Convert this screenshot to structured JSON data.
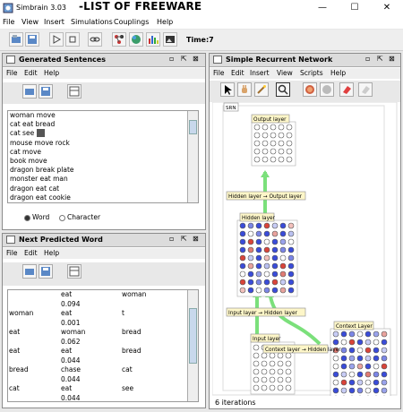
{
  "app": {
    "title": "Simbrain 3.03",
    "overlay_title": "-LIST OF FREEWARE",
    "window_controls": [
      "—",
      "☐",
      "✕"
    ]
  },
  "menubar": [
    "File",
    "View",
    "Insert",
    "Simulations",
    "Couplings",
    "Help"
  ],
  "toolbar": {
    "time_label": "Time:7"
  },
  "generated": {
    "title": "Generated Sentences",
    "menu": [
      "File",
      "Edit",
      "Help"
    ],
    "sentences": [
      "woman move",
      "cat eat bread",
      "cat see",
      "mouse move rock",
      "cat move",
      "book move",
      "dragon break plate",
      "monster eat man",
      "dragon eat cat",
      "dragon eat cookie"
    ],
    "radio_word": "Word",
    "radio_character": "Character"
  },
  "predicted": {
    "title": "Next Predicted Word",
    "menu": [
      "File",
      "Edit",
      "Help"
    ],
    "rows": [
      {
        "a": "",
        "b": "eat",
        "c": "woman"
      },
      {
        "a": "",
        "b": "0.094",
        "c": ""
      },
      {
        "a": "woman",
        "b": "eat",
        "c": "t"
      },
      {
        "a": "",
        "b": "0.001",
        "c": ""
      },
      {
        "a": "eat",
        "b": "woman",
        "c": "bread"
      },
      {
        "a": "",
        "b": "0.062",
        "c": ""
      },
      {
        "a": "eat",
        "b": "eat",
        "c": "bread"
      },
      {
        "a": "",
        "b": "0.044",
        "c": ""
      },
      {
        "a": "bread",
        "b": "chase",
        "c": "cat"
      },
      {
        "a": "",
        "b": "0.044",
        "c": ""
      },
      {
        "a": "cat",
        "b": "eat",
        "c": "see"
      },
      {
        "a": "",
        "b": "0.044",
        "c": ""
      }
    ]
  },
  "srn": {
    "title": "Simple Recurrent Network",
    "menu": [
      "File",
      "Edit",
      "Insert",
      "View",
      "Scripts",
      "Help"
    ],
    "tag": "SRN",
    "labels": {
      "output_layer": "Output layer",
      "hidden_to_output": "Hidden layer → Output layer",
      "hidden_layer": "Hidden layer",
      "input_to_hidden": "Input layer → Hidden layer",
      "input_layer": "Input layer",
      "context_to_hidden": "Context layer → Hidden layer",
      "context_layer": "Context Layer"
    },
    "status": "6 iterations"
  },
  "colors": {
    "titlebar": "#ffffff",
    "panel_title": "#dcdcdc",
    "arrow": "#7be07b",
    "neuron_high": "#d9443a",
    "neuron_neg": "#3a4cd9",
    "label_bg": "#fdf6c8"
  },
  "icons": [
    "app-logo-icon",
    "open-icon",
    "save-icon",
    "play-icon",
    "stop-icon",
    "couplings-icon",
    "network-icon",
    "world-icon",
    "chart-icon",
    "image-icon",
    "arrow-select-icon",
    "hand-icon",
    "wand-icon",
    "zoom-icon",
    "clamp-icon",
    "circle-icon",
    "eraser-icon",
    "clear-icon"
  ]
}
